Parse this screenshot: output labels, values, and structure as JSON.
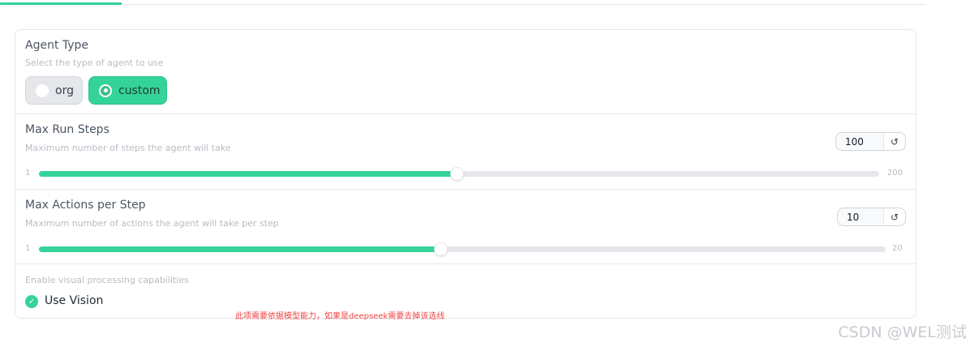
{
  "colors": {
    "accent": "#34d399",
    "note": "#ef4444"
  },
  "agent_type": {
    "title": "Agent Type",
    "description": "Select the type of agent to use",
    "options": [
      {
        "label": "org",
        "selected": false
      },
      {
        "label": "custom",
        "selected": true
      }
    ]
  },
  "max_run_steps": {
    "title": "Max Run Steps",
    "description": "Maximum number of steps the agent will take",
    "value": "100",
    "min": "1",
    "max": "200",
    "reset_icon": "↺",
    "slider_fraction": 0.497
  },
  "max_actions": {
    "title": "Max Actions per Step",
    "description": "Maximum number of actions the agent will take per step",
    "value": "10",
    "min": "1",
    "max": "20",
    "reset_icon": "↺",
    "slider_fraction": 0.474
  },
  "vision": {
    "description": "Enable visual processing capabilities",
    "label": "Use Vision",
    "checked": true,
    "check_icon": "✓"
  },
  "note": "此项需要依据模型能力，如果是deepseek需要去掉该选线",
  "watermark": "CSDN @WEL测试"
}
